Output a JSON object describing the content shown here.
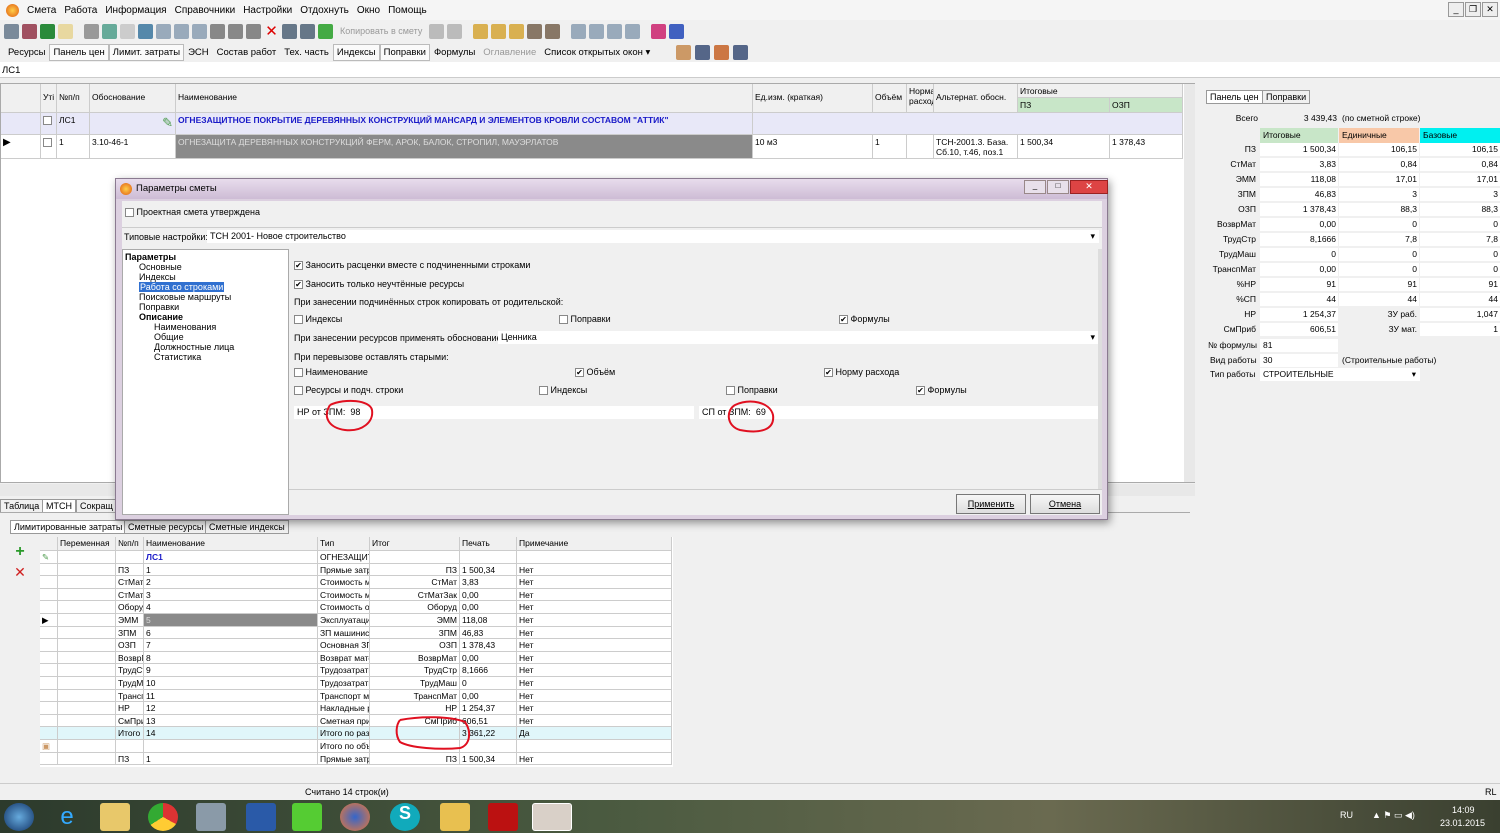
{
  "menu": [
    "Смета",
    "Работа",
    "Информация",
    "Справочники",
    "Настройки",
    "Отдохнуть",
    "Окно",
    "Помощь"
  ],
  "toolbar": {
    "copy_to_estimate": "Копировать в смету"
  },
  "toolbar2": [
    "Ресурсы",
    "Панель цен",
    "Лимит. затраты",
    "ЭСН",
    "Состав работ",
    "Тех. часть",
    "Индексы",
    "Поправки",
    "Формулы",
    "Оглавление",
    "Список открытых окон ▾"
  ],
  "address": "ЛС1",
  "main_grid": {
    "headers": {
      "uti": "Уті",
      "num": "№п/п",
      "basis": "Обоснование",
      "name": "Наименование",
      "unit": "Ед.изм. (краткая)",
      "volume": "Объём",
      "norm": "Норма расхода",
      "alt": "Альтернат. обосн.",
      "totals": "Итоговые",
      "pz": "ПЗ",
      "ozp": "ОЗП"
    },
    "rows": [
      {
        "num": "ЛС1",
        "basis": "",
        "name": "ОГНЕЗАЩИТНОЕ ПОКРЫТИЕ ДЕРЕВЯННЫХ КОНСТРУКЦИЙ МАНСАРД И ЭЛЕМЕНТОВ КРОВЛИ СОСТАВОМ \"АТТИК\"",
        "unit": "",
        "volume": "",
        "alt": "",
        "pz": "",
        "ozp": ""
      },
      {
        "num": "1",
        "basis": "3.10-46-1",
        "name": "ОГНЕЗАЩИТА ДЕРЕВЯННЫХ КОНСТРУКЦИЙ ФЕРМ, АРОК, БАЛОК, СТРОПИЛ, МАУЭРЛАТОВ",
        "unit": "10 м3",
        "volume": "1",
        "alt": "ТСН-2001.3. База. Сб.10, т.46, поз.1",
        "pz": "1 500,34",
        "ozp": "1 378,43"
      }
    ]
  },
  "price_panel": {
    "tabs": [
      "Панель цен",
      "Поправки"
    ],
    "total_label": "Всего",
    "total_value": "3 439,43",
    "total_note": "(по сметной строке)",
    "col_headers": [
      "Итоговые",
      "Единичные",
      "Базовые"
    ],
    "rows": [
      [
        "ПЗ",
        "1 500,34",
        "106,15",
        "106,15"
      ],
      [
        "СтМат",
        "3,83",
        "0,84",
        "0,84"
      ],
      [
        "ЭММ",
        "118,08",
        "17,01",
        "17,01"
      ],
      [
        "ЗПМ",
        "46,83",
        "3",
        "3"
      ],
      [
        "ОЗП",
        "1 378,43",
        "88,3",
        "88,3"
      ],
      [
        "ВозврМат",
        "0,00",
        "0",
        "0"
      ],
      [
        "ТрудСтр",
        "8,1666",
        "7,8",
        "7,8"
      ],
      [
        "ТрудМаш",
        "0",
        "0",
        "0"
      ],
      [
        "ТранспМат",
        "0,00",
        "0",
        "0"
      ],
      [
        "%НР",
        "91",
        "91",
        "91"
      ],
      [
        "%СП",
        "44",
        "44",
        "44"
      ],
      [
        "НР",
        "1 254,37",
        "ЗУ раб.",
        "1,047"
      ],
      [
        "СмПриб",
        "606,51",
        "ЗУ мат.",
        "1"
      ]
    ],
    "formula_label": "№ формулы",
    "formula_value": "81",
    "work_kind_label": "Вид работы",
    "work_kind_value": "30",
    "work_kind_note": "(Строительные работы)",
    "work_type_label": "Тип работы",
    "work_type_value": "СТРОИТЕЛЬНЫЕ"
  },
  "dialog": {
    "title": "Параметры сметы",
    "approved": {
      "label": "Проектная смета утверждена",
      "checked": false
    },
    "preset_label": "Типовые настройки:",
    "preset_value": "ТСН 2001- Новое строительство",
    "tree": {
      "root": "Параметры",
      "items": [
        "Основные",
        "Индексы",
        "Работа со строками",
        "Поисковые маршруты",
        "Поправки"
      ],
      "desc": "Описание",
      "desc_items": [
        "Наименования",
        "Общие",
        "Должностные лица",
        "Статистика"
      ],
      "selected": "Работа со строками"
    },
    "opt1": {
      "label": "Заносить расценки вместе с подчиненными строками",
      "checked": true
    },
    "opt2": {
      "label": "Заносить только неучтённые ресурсы",
      "checked": true
    },
    "copy_label": "При занесении подчинённых строк копировать от родительской:",
    "copy_opts": [
      {
        "label": "Индексы",
        "checked": false
      },
      {
        "label": "Поправки",
        "checked": false
      },
      {
        "label": "Формулы",
        "checked": true
      }
    ],
    "basis_label": "При занесении ресурсов применять обоснование:",
    "basis_value": "Ценника",
    "keep_label": "При перевызове оставлять старыми:",
    "keep_opts": [
      {
        "label": "Наименование",
        "checked": false
      },
      {
        "label": "Объём",
        "checked": true
      },
      {
        "label": "Норму расхода",
        "checked": true
      },
      {
        "label": "Ресурсы и подч. строки",
        "checked": false
      },
      {
        "label": "Индексы",
        "checked": false
      },
      {
        "label": "Поправки",
        "checked": false
      },
      {
        "label": "Формулы",
        "checked": true
      }
    ],
    "nr_label": "НР от ЗПМ:",
    "nr_value": "98",
    "sp_label": "СП от ЗПМ:",
    "sp_value": "69",
    "apply": "Применить",
    "cancel": "Отмена"
  },
  "bottom_tabs": [
    "Таблица",
    "МТСН",
    "Сокращ"
  ],
  "lower_tabs": [
    "Лимитированные затраты",
    "Сметные ресурсы",
    "Сметные индексы"
  ],
  "lower_grid": {
    "headers": [
      "Переменная",
      "№п/п",
      "Наименование",
      "Тип",
      "Итог",
      "Печать",
      "Примечание"
    ],
    "rows": [
      [
        "",
        "ЛС1",
        "ОГНЕЗАЩИТНОЕ ПОКРЫТИЕ ДЕРЕВ",
        "",
        "",
        "",
        ""
      ],
      [
        "ПЗ",
        "1",
        "Прямые затраты",
        "ПЗ",
        "1 500,34",
        "Нет",
        ""
      ],
      [
        "СтМат",
        "2",
        "Стоимость материальных ресурсов",
        "СтМат",
        "3,83",
        "Нет",
        ""
      ],
      [
        "СтМатЗак",
        "3",
        "Стоимость материалов заказчика",
        "СтМатЗак",
        "0,00",
        "Нет",
        ""
      ],
      [
        "Оборуд",
        "4",
        "Стоимость оборудования",
        "Оборуд",
        "0,00",
        "Нет",
        ""
      ],
      [
        "ЭММ",
        "5",
        "Эксплуатация машин",
        "ЭММ",
        "118,08",
        "Нет",
        ""
      ],
      [
        "ЗПМ",
        "6",
        "ЗП машинистов",
        "ЗПМ",
        "46,83",
        "Нет",
        ""
      ],
      [
        "ОЗП",
        "7",
        "Основная ЗП рабочих",
        "ОЗП",
        "1 378,43",
        "Нет",
        ""
      ],
      [
        "ВозврМат",
        "8",
        "Возврат материалов",
        "ВозврМат",
        "0,00",
        "Нет",
        ""
      ],
      [
        "ТрудСтр",
        "9",
        "Трудозатраты строителей",
        "ТрудСтр",
        "8,1666",
        "Нет",
        ""
      ],
      [
        "ТрудМаш",
        "10",
        "Трудозатраты машинистов",
        "ТрудМаш",
        "0",
        "Нет",
        ""
      ],
      [
        "ТранспМат",
        "11",
        "Транспорт материалов",
        "ТранспМат",
        "0,00",
        "Нет",
        ""
      ],
      [
        "НР",
        "12",
        "Накладные расходы",
        "НР",
        "1 254,37",
        "Нет",
        ""
      ],
      [
        "СмПриб",
        "13",
        "Сметная прибыль",
        "СмПриб",
        "606,51",
        "Нет",
        ""
      ],
      [
        "Итого",
        "14",
        "Итого по разделу",
        "",
        "3 361,22",
        "Да",
        ""
      ],
      [
        "",
        "",
        "Итого по объекту:",
        "",
        "",
        "",
        ""
      ],
      [
        "ПЗ",
        "1",
        "Прямые затраты",
        "ПЗ",
        "1 500,34",
        "Нет",
        ""
      ]
    ]
  },
  "status": {
    "text": "Считано 14 строк(и)",
    "right": "RL"
  },
  "taskbar": {
    "lang": "RU",
    "time": "14:09",
    "date": "23.01.2015"
  },
  "colors": {
    "header_blue": "#1a1ac8",
    "total_green": "#1a8a1a",
    "annotation": "#e01020",
    "panel_green": "#c8e6c8",
    "panel_orange": "#f8c8a8",
    "panel_cyan": "#00f0f0"
  }
}
